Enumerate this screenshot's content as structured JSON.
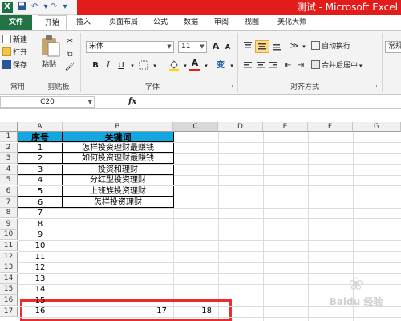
{
  "titlebar": {
    "logo": "X",
    "doc_title": "测试 - Microsoft Excel",
    "qat": [
      "save-icon",
      "undo-icon",
      "redo-icon",
      "customize-icon"
    ]
  },
  "tabs": [
    "文件",
    "开始",
    "插入",
    "页面布局",
    "公式",
    "数据",
    "审阅",
    "视图",
    "美化大师"
  ],
  "ribbon": {
    "clipboard": {
      "new": "新建",
      "open": "打开",
      "save": "保存",
      "paste": "粘贴",
      "group_common": "常用",
      "group_clipboard": "剪贴板"
    },
    "font": {
      "name": "宋体",
      "size": "11",
      "bold": "B",
      "italic": "I",
      "underline": "U",
      "grow": "A",
      "shrink": "A",
      "font_color_label": "A",
      "phonetic": "变",
      "group_font": "字体",
      "font_color": "#e31b1b",
      "fill_color": "#ffd700"
    },
    "alignment": {
      "wrap": "自动换行",
      "merge": "合并后居中",
      "group_align": "对齐方式"
    },
    "number": {
      "format": "常规"
    }
  },
  "formula_bar": {
    "name_box": "C20",
    "fx": "fx",
    "formula": ""
  },
  "columns": [
    "A",
    "B",
    "C",
    "D",
    "E",
    "F",
    "G"
  ],
  "rows": [
    "1",
    "2",
    "3",
    "4",
    "5",
    "6",
    "7",
    "8",
    "9",
    "10",
    "11",
    "12",
    "13",
    "14",
    "15",
    "16",
    "17"
  ],
  "table": {
    "header": [
      "序号",
      "关键词"
    ],
    "seq": [
      "1",
      "2",
      "3",
      "4",
      "5",
      "6",
      "7",
      "8",
      "9",
      "10",
      "11",
      "12",
      "13",
      "14",
      "15",
      "16"
    ],
    "keywords": [
      "怎样投资理财最赚钱",
      "如何投资理财最赚钱",
      "投资和理财",
      "分红型投资理财",
      "上班族投资理财",
      "怎样投资理财"
    ],
    "row17_b": "17",
    "row17_c": "18"
  },
  "watermark": {
    "text": "Baidu 经验",
    "logo": "paw-icon"
  },
  "colors": {
    "file_tab": "#217346",
    "header_fill": "#13a7e0",
    "highlight": "#ee2a2a"
  }
}
